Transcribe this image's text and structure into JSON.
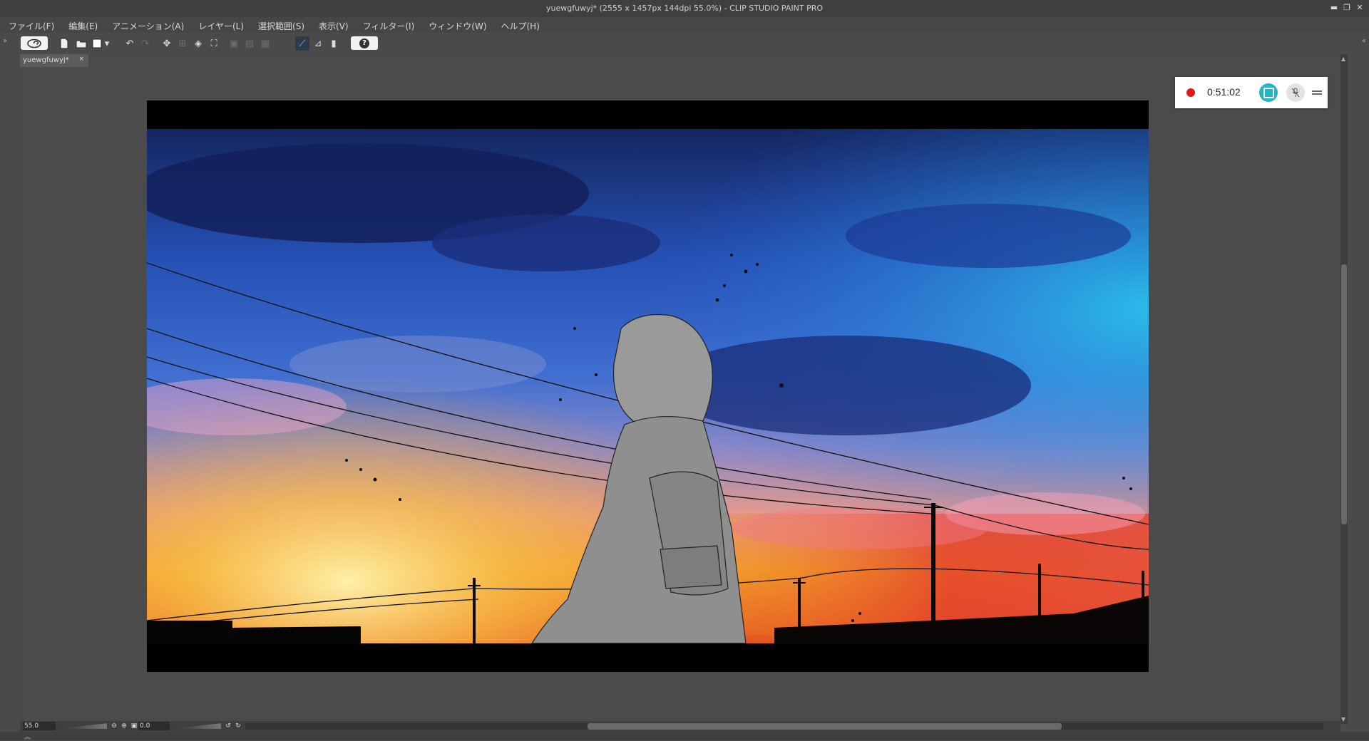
{
  "window": {
    "title": "yuewgfuwyj* (2555 x 1457px 144dpi 55.0%)  - CLIP STUDIO PAINT PRO",
    "minimize_glyph": "▬",
    "restore_glyph": "❐",
    "close_glyph": "✕"
  },
  "menu": {
    "items": [
      "ファイル(F)",
      "編集(E)",
      "アニメーション(A)",
      "レイヤー(L)",
      "選択範囲(S)",
      "表示(V)",
      "フィルター(I)",
      "ウィンドウ(W)",
      "ヘルプ(H)"
    ]
  },
  "toolbar": {
    "icons": [
      "clip-studio-logo-icon",
      "new-file-icon",
      "open-file-icon",
      "save-icon",
      "dropdown-arrow-icon",
      "undo-icon",
      "redo-icon",
      "transform-icon",
      "move-icon",
      "fill-icon",
      "crop-icon",
      "rotate-icon",
      "flip-icon",
      "copy-icon",
      "snap-ruler-icon",
      "snap-grid-icon",
      "snap-special-ruler-icon",
      "help-icon"
    ],
    "help_glyph": "?"
  },
  "document": {
    "tab_name": "yuewgfuwyj*",
    "tab_close": "×"
  },
  "recorder": {
    "time": "0:51:02",
    "colors": {
      "record": "#e21818",
      "stop": "#22b7c6"
    },
    "mic_glyph": "🎙"
  },
  "status": {
    "zoom": "55.0",
    "rotation": "0.0"
  },
  "colors": {
    "workspace": "#4b4b4b",
    "chrome": "#3f3f3f",
    "sky_top": "#1a2f73",
    "sky_mid": "#2f66d6",
    "sunset": "#f3a02a"
  }
}
